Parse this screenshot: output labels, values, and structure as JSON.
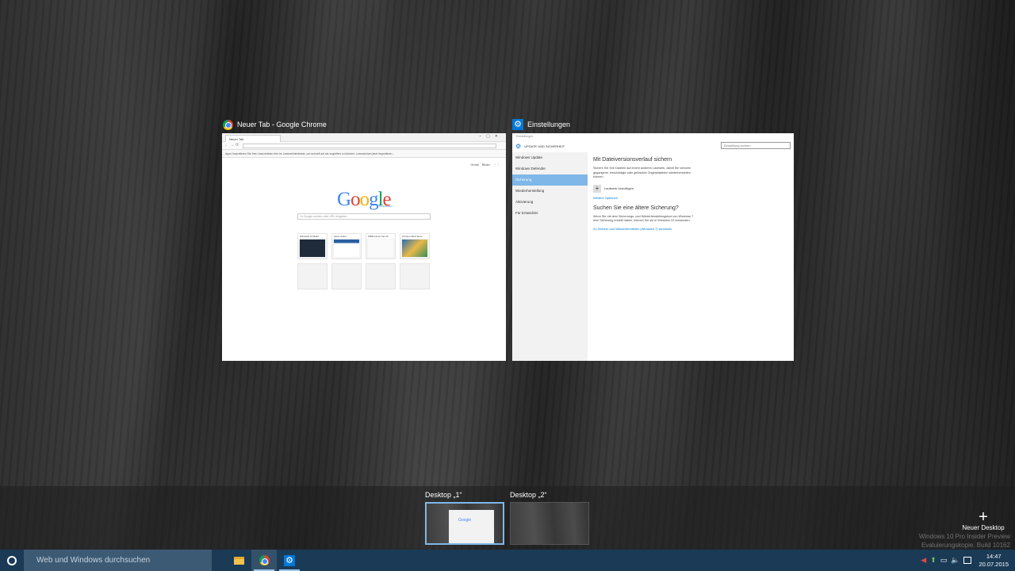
{
  "windows": {
    "chrome": {
      "title": "Neuer Tab - Google Chrome",
      "tab_label": "Neuer Tab",
      "info_bar": "Apps   Importieren Sie Ihre Lesezeichen hier im Lesezeichenleiste, um schnell auf sie zugreifen zu können. Lesezeichen jetzt importieren...",
      "top_links": [
        "Gmail",
        "Bilder"
      ],
      "logo_letters": [
        {
          "ch": "G",
          "color": "#4285f4"
        },
        {
          "ch": "o",
          "color": "#db4437"
        },
        {
          "ch": "o",
          "color": "#f4b400"
        },
        {
          "ch": "g",
          "color": "#4285f4"
        },
        {
          "ch": "l",
          "color": "#0f9d58"
        },
        {
          "ch": "e",
          "color": "#db4437"
        }
      ],
      "logo_sub": "Deutschland",
      "search_placeholder": "In Google suchen oder URL eingeben",
      "tiles": [
        {
          "label": "Windows 10 Build"
        },
        {
          "label": "heise online"
        },
        {
          "label": "Willkommen bei Ch"
        },
        {
          "label": "Chrome Web Store"
        },
        {
          "label": ""
        },
        {
          "label": ""
        },
        {
          "label": ""
        },
        {
          "label": ""
        }
      ]
    },
    "settings": {
      "title": "Einstellungen",
      "top_label": "Einstellungen",
      "header": "UPDATE UND SICHERHEIT",
      "search_placeholder": "Einstellung suchen",
      "nav": [
        "Windows Update",
        "Windows Defender",
        "Sicherung",
        "Wiederherstellung",
        "Aktivierung",
        "Für Entwickler"
      ],
      "selected_nav": "Sicherung",
      "section1_title": "Mit Dateiversionsverlauf sichern",
      "section1_text": "Sichern Sie Ihre Dateien auf einem anderen Laufwerk, damit Sie verloren gegangene, beschädigte oder gelöschte Originaldateien wiederherstellen können.",
      "add_drive": "Laufwerk hinzufügen",
      "more_options": "Weitere Optionen",
      "section2_title": "Suchen Sie eine ältere Sicherung?",
      "section2_text": "Wenn Sie mit dem Sicherungs- und Wiederherstellungstool von Windows 7 eine Sicherung erstellt haben, können Sie sie in Windows 10 verwenden.",
      "section2_link": "Zu Sichern und Wiederherstellen (Windows 7) wechseln"
    }
  },
  "desktops": [
    {
      "label": "Desktop „1“",
      "active": true
    },
    {
      "label": "Desktop „2“",
      "active": false
    }
  ],
  "new_desktop_label": "Neuer Desktop",
  "watermark": [
    "Windows 10 Pro Insider Preview",
    "Evaluierungskopie. Build 10162"
  ],
  "taskbar": {
    "search_placeholder": "Web und Windows durchsuchen",
    "time": "14:47",
    "date": "20.07.2015",
    "accent": "#0078d7"
  }
}
